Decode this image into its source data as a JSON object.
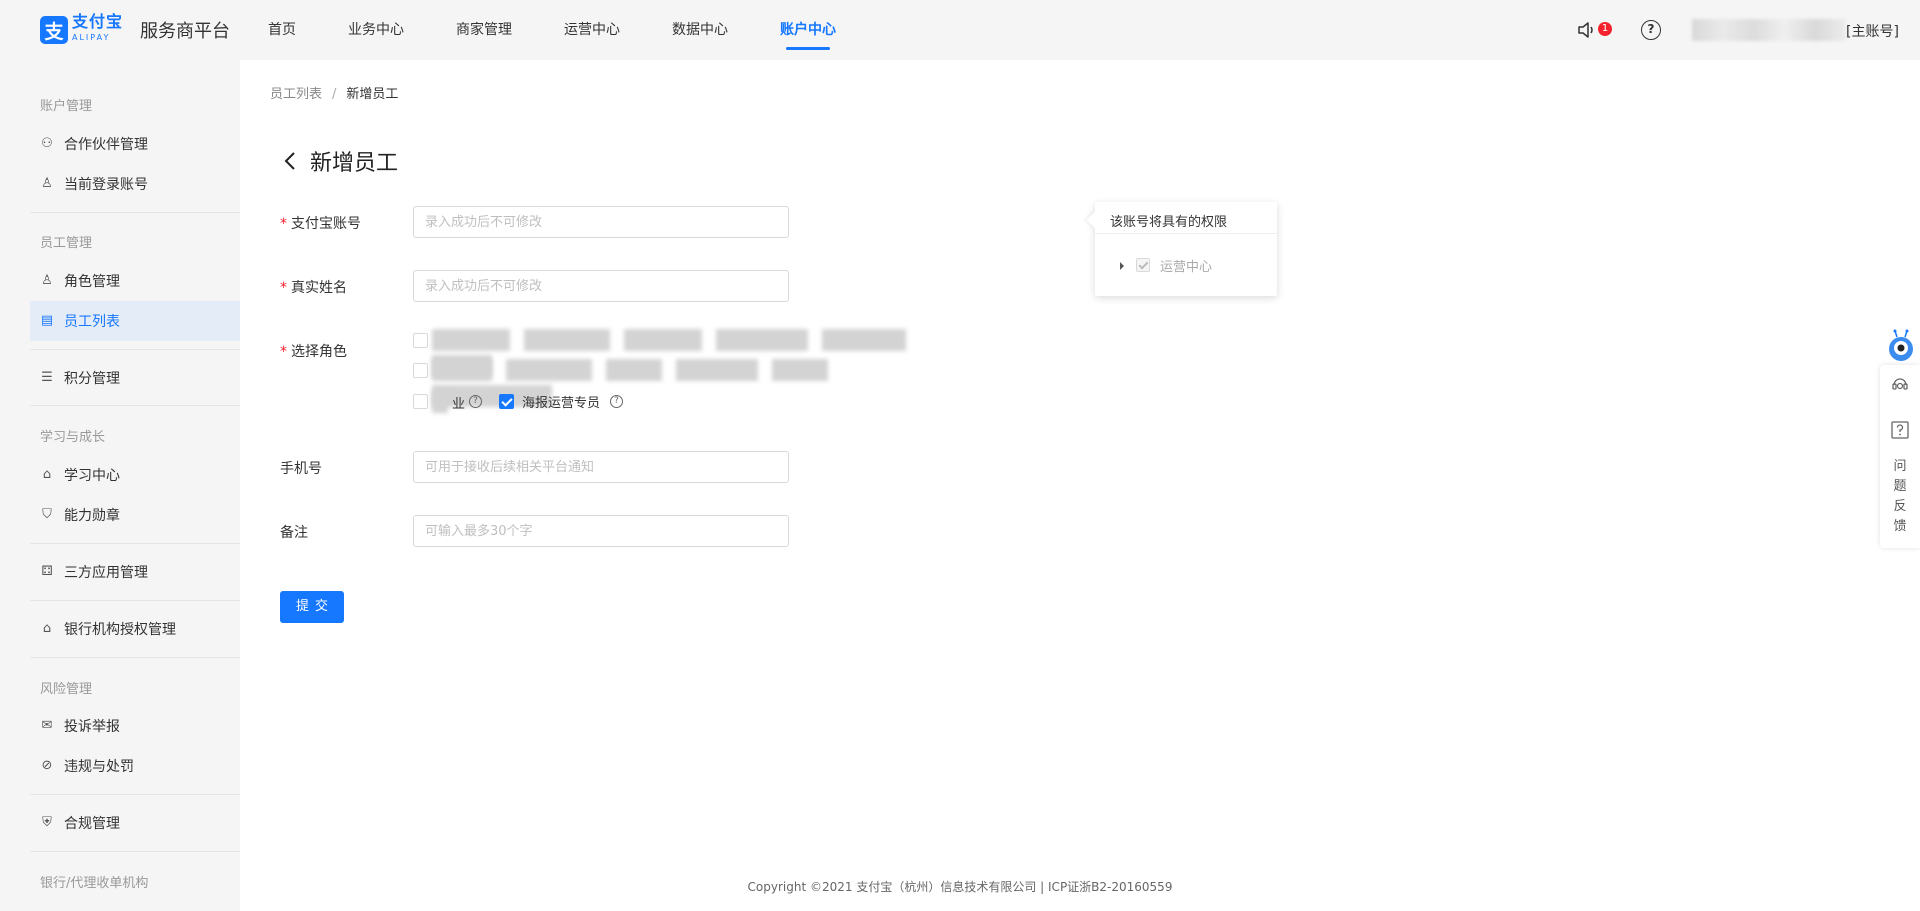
{
  "header": {
    "logo_cn": "支付宝",
    "logo_en": "ALIPAY",
    "logo_glyph": "支",
    "platform_name": "服务商平台",
    "nav": [
      {
        "label": "首页",
        "active": false
      },
      {
        "label": "业务中心",
        "active": false
      },
      {
        "label": "商家管理",
        "active": false
      },
      {
        "label": "运营中心",
        "active": false
      },
      {
        "label": "数据中心",
        "active": false
      },
      {
        "label": "账户中心",
        "active": true
      }
    ],
    "notification_count": "1",
    "help_glyph": "?",
    "account_suffix": "[主账号]"
  },
  "sidebar": {
    "groups": [
      "账户管理",
      "员工管理",
      "学习与成长",
      "风险管理",
      "银行/代理收单机构"
    ],
    "items": [
      {
        "label": "合作伙伴管理",
        "icon": "partner-icon"
      },
      {
        "label": "当前登录账号",
        "icon": "user-icon"
      },
      {
        "label": "角色管理",
        "icon": "role-icon"
      },
      {
        "label": "员工列表",
        "icon": "staff-list-icon",
        "active": true
      },
      {
        "label": "积分管理",
        "icon": "points-icon"
      },
      {
        "label": "学习中心",
        "icon": "learning-icon"
      },
      {
        "label": "能力勋章",
        "icon": "medal-icon"
      },
      {
        "label": "三方应用管理",
        "icon": "apps-icon"
      },
      {
        "label": "银行机构授权管理",
        "icon": "bank-icon"
      },
      {
        "label": "投诉举报",
        "icon": "mail-icon"
      },
      {
        "label": "违规与处罚",
        "icon": "ban-icon"
      },
      {
        "label": "合规管理",
        "icon": "shield-icon"
      }
    ]
  },
  "breadcrumb": {
    "parent": "员工列表",
    "separator": "/",
    "current": "新增员工"
  },
  "page_title": "新增员工",
  "form": {
    "alipay_account": {
      "label": "支付宝账号",
      "placeholder": "录入成功后不可修改"
    },
    "real_name": {
      "label": "真实姓名",
      "placeholder": "录入成功后不可修改"
    },
    "role": {
      "label": "选择角色",
      "partial_label": "业",
      "poster_label": "海报运营专员",
      "poster_checked": true
    },
    "phone": {
      "label": "手机号",
      "placeholder": "可用于接收后续相关平台通知"
    },
    "remark": {
      "label": "备注",
      "placeholder": "可输入最多30个字"
    },
    "required_mark": "*",
    "submit_label": "提交"
  },
  "permission_panel": {
    "title": "该账号将具有的权限",
    "items": [
      {
        "label": "运营中心",
        "checked": true,
        "disabled": true
      }
    ]
  },
  "float_bar": {
    "feedback_chars": [
      "问",
      "题",
      "反",
      "馈"
    ]
  },
  "footer": "Copyright ©2021 支付宝（杭州）信息技术有限公司  |  ICP证浙B2-20160559"
}
